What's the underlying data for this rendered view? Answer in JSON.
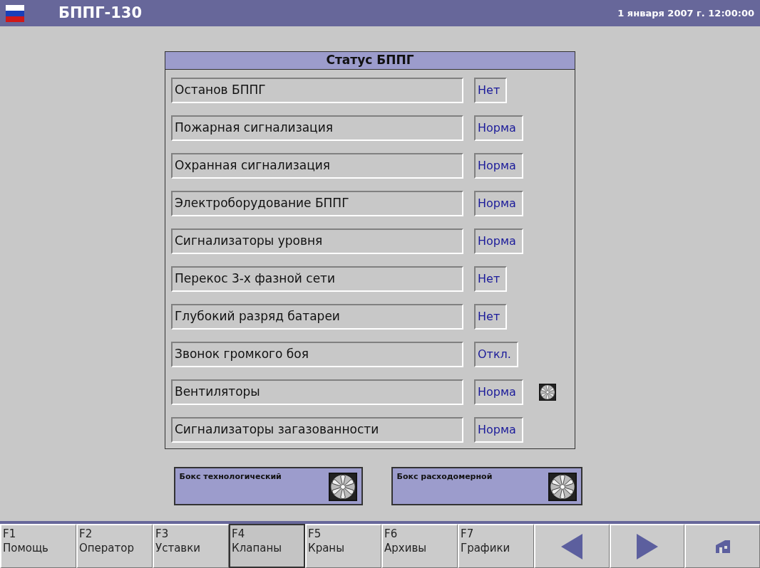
{
  "header": {
    "title": "БППГ-130",
    "datetime": "1 января 2007 г. 12:00:00"
  },
  "panel": {
    "title": "Статус БППГ",
    "rows": [
      {
        "label": "Останов БППГ",
        "value": "Нет",
        "kind": "plain"
      },
      {
        "label": "Пожарная сигнализация",
        "value": "Норма",
        "kind": "plain"
      },
      {
        "label": "Охранная сигнализация",
        "value": "Норма",
        "kind": "plain"
      },
      {
        "label": "Электроборудование БППГ",
        "value": "Норма",
        "kind": "plain"
      },
      {
        "label": "Сигнализаторы уровня",
        "value": "Норма",
        "kind": "plain"
      },
      {
        "label": "Перекос 3-х фазной сети",
        "value": "Нет",
        "kind": "plain"
      },
      {
        "label": "Глубокий разряд батареи",
        "value": "Нет",
        "kind": "plain"
      },
      {
        "label": "Звонок громкого боя",
        "value": "Откл.",
        "kind": "plain"
      },
      {
        "label": "Вентиляторы",
        "value": "Норма",
        "kind": "fan"
      },
      {
        "label": "Сигнализаторы загазованности",
        "value": "Норма",
        "kind": "plain"
      }
    ]
  },
  "boxes": [
    {
      "label": "Бокс технологический"
    },
    {
      "label": "Бокс расходомерной"
    }
  ],
  "function_keys": [
    {
      "key": "F1",
      "label": "Помощь",
      "selected": false
    },
    {
      "key": "F2",
      "label": "Оператор",
      "selected": false
    },
    {
      "key": "F3",
      "label": "Уставки",
      "selected": false
    },
    {
      "key": "F4",
      "label": "Клапаны",
      "selected": true
    },
    {
      "key": "F5",
      "label": "Краны",
      "selected": false
    },
    {
      "key": "F6",
      "label": "Архивы",
      "selected": false
    },
    {
      "key": "F7",
      "label": "Графики",
      "selected": false
    }
  ],
  "nav_buttons": [
    {
      "kind": "back"
    },
    {
      "kind": "forward"
    },
    {
      "kind": "home"
    }
  ]
}
